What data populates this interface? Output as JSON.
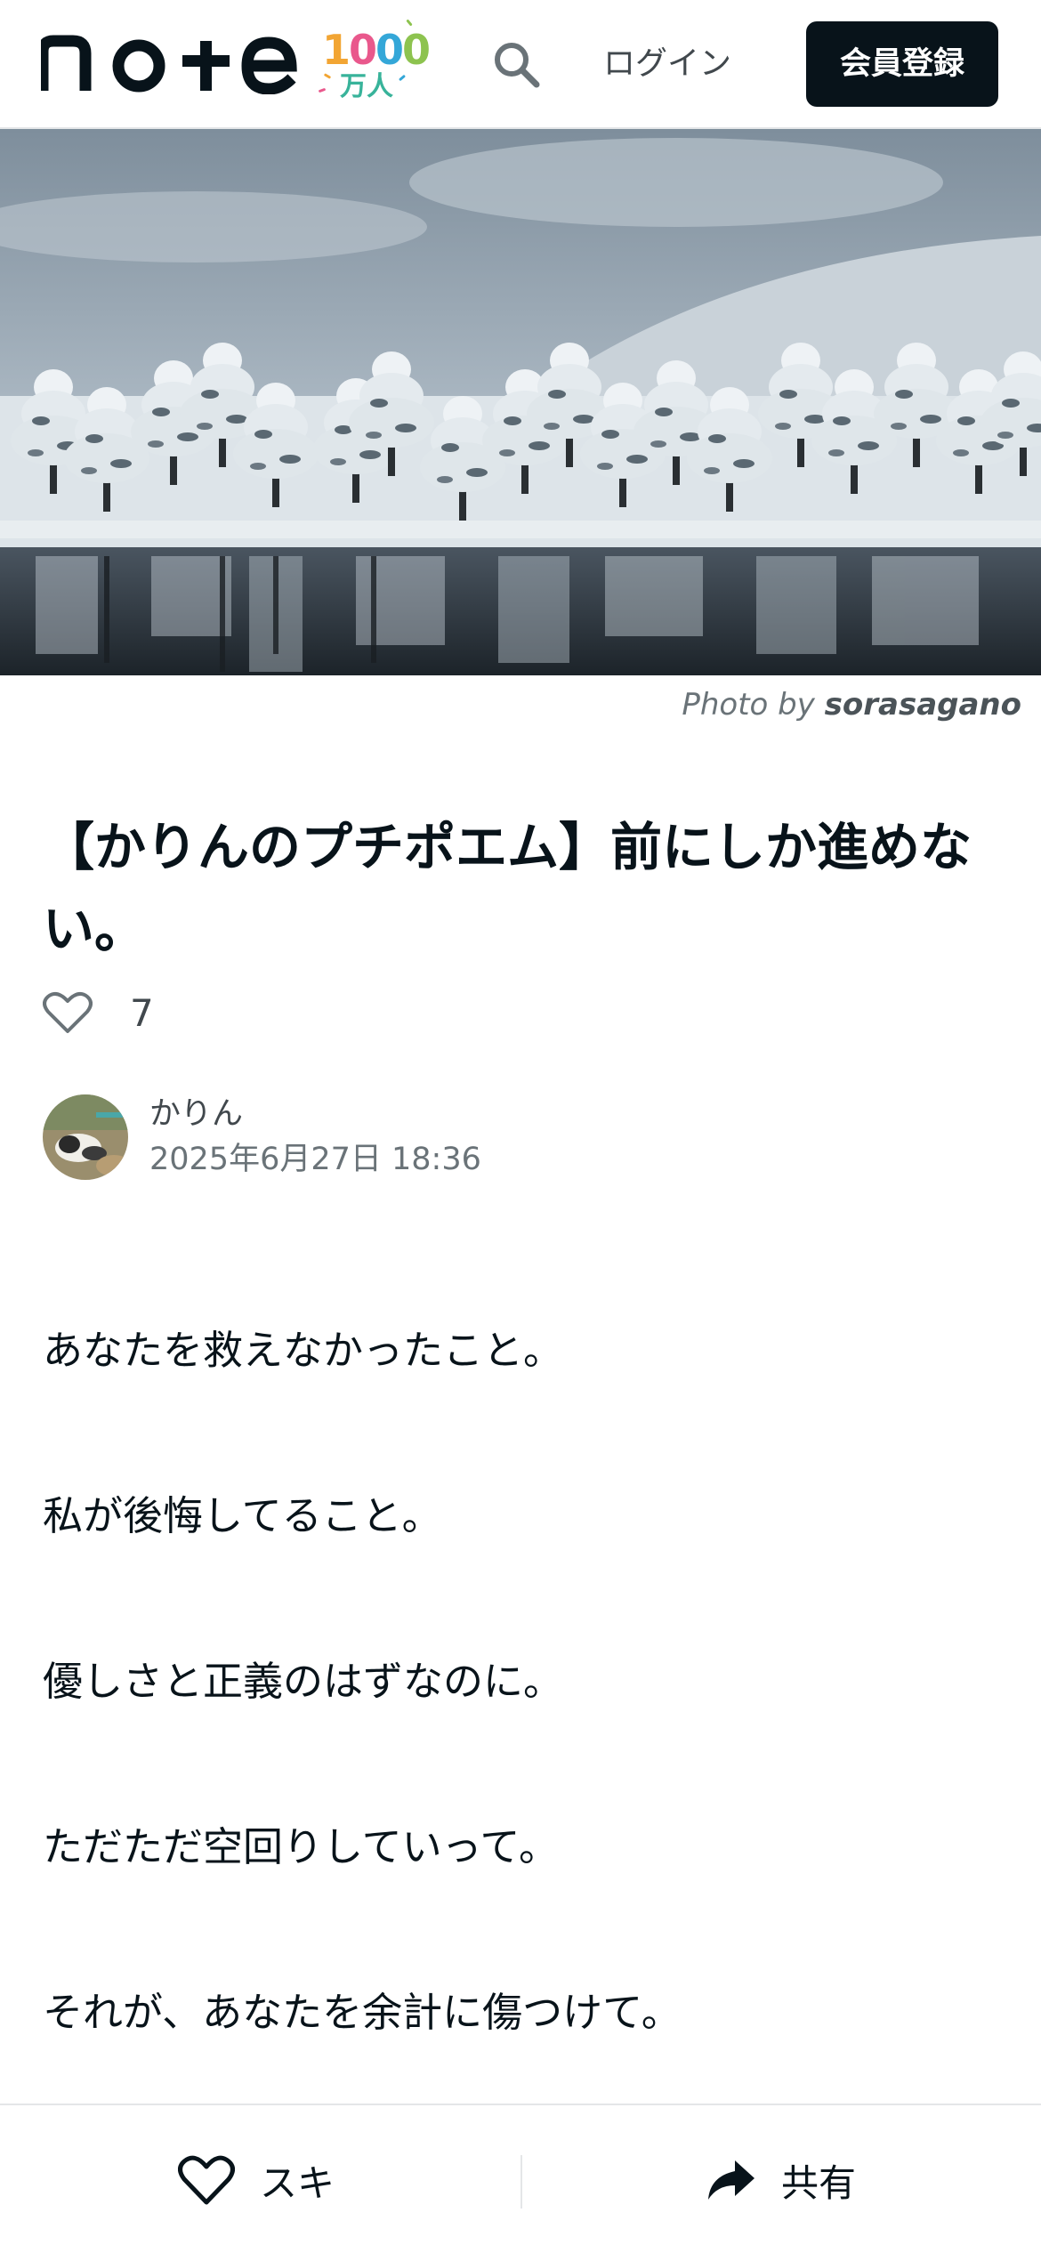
{
  "header": {
    "logo_text": "note",
    "milestone_digits": [
      "1",
      "0",
      "0",
      "0"
    ],
    "milestone_unit": "万人",
    "search_icon": "search-icon",
    "login_label": "ログイン",
    "signup_label": "会員登録"
  },
  "hero": {
    "photo_credit_prefix": "Photo by",
    "photo_credit_author": "sorasagano"
  },
  "article": {
    "title": "【かりんのプチポエム】前にしか進めない。",
    "like_count": "7",
    "author_name": "かりん",
    "published_at": "2025年6月27日 18:36",
    "paragraphs": [
      "あなたを救えなかったこと。",
      "私が後悔してること。",
      "優しさと正義のはずなのに。",
      "ただただ空回りしていって。",
      "それが、あなたを余計に傷つけて。"
    ]
  },
  "action_bar": {
    "like_label": "スキ",
    "share_label": "共有",
    "like_icon": "heart-icon",
    "share_icon": "share-arrow-icon"
  },
  "colors": {
    "brand_dark": "#08131a",
    "text_muted": "#6a7378",
    "border": "#e4e6e8"
  }
}
